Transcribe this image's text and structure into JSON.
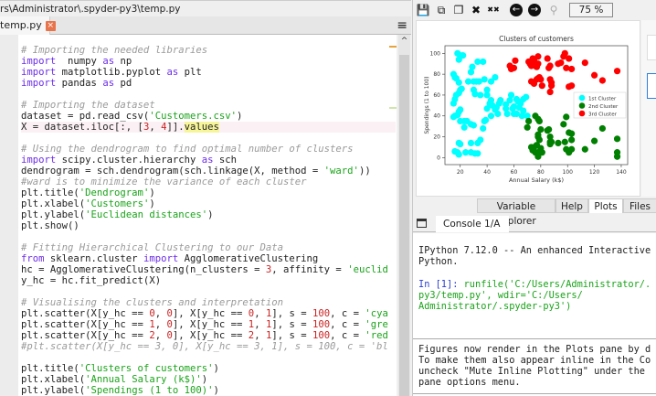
{
  "editor": {
    "path": "rs\\Administrator\\.spyder-py3\\temp.py",
    "tab_label": "temp.py",
    "close_glyph": "×",
    "menu_glyph": "≡",
    "scroll_up_glyph": "^",
    "lines": [
      [
        [
          "cm",
          "# Importing the needed libraries"
        ]
      ],
      [
        [
          "kw",
          "import"
        ],
        [
          "",
          "  numpy "
        ],
        [
          "kw",
          "as"
        ],
        [
          "",
          " np"
        ]
      ],
      [
        [
          "kw",
          "import"
        ],
        [
          "",
          " matplotlib.pyplot "
        ],
        [
          "kw",
          "as"
        ],
        [
          "",
          " plt"
        ]
      ],
      [
        [
          "kw",
          "import"
        ],
        [
          "",
          " pandas "
        ],
        [
          "kw",
          "as"
        ],
        [
          "",
          " pd"
        ]
      ],
      [],
      [
        [
          "cm",
          "# Importing the dataset"
        ]
      ],
      [
        [
          "",
          "dataset = pd.read_csv("
        ],
        [
          "st",
          "'Customers.csv'"
        ],
        [
          "",
          ")"
        ]
      ],
      [
        [
          "",
          "X = dataset.iloc[:, ["
        ],
        [
          "nu",
          "3"
        ],
        [
          "",
          ", "
        ],
        [
          "nu",
          "4"
        ],
        [
          "",
          "]]."
        ],
        [
          "hl",
          "values"
        ]
      ],
      [],
      [
        [
          "cm",
          "# Using the dendrogram to find optimal number of clusters"
        ]
      ],
      [
        [
          "kw",
          "import"
        ],
        [
          "",
          " scipy.cluster.hierarchy "
        ],
        [
          "kw",
          "as"
        ],
        [
          "",
          " sch"
        ]
      ],
      [
        [
          "",
          "dendrogram = sch.dendrogram(sch.linkage(X, method = "
        ],
        [
          "st",
          "'ward'"
        ],
        [
          "",
          "))"
        ]
      ],
      [
        [
          "cm",
          "#ward is to minimize the variance of each cluster"
        ]
      ],
      [
        [
          "",
          "plt.title("
        ],
        [
          "st",
          "'Dendrogram'"
        ],
        [
          "",
          ")"
        ]
      ],
      [
        [
          "",
          "plt.xlabel("
        ],
        [
          "st",
          "'Customers'"
        ],
        [
          "",
          ")"
        ]
      ],
      [
        [
          "",
          "plt.ylabel("
        ],
        [
          "st",
          "'Euclidean distances'"
        ],
        [
          "",
          ")"
        ]
      ],
      [
        [
          "",
          "plt.show()"
        ]
      ],
      [],
      [
        [
          "cm",
          "# Fitting Hierarchical Clustering to our Data"
        ]
      ],
      [
        [
          "kw",
          "from"
        ],
        [
          "",
          " sklearn.cluster "
        ],
        [
          "kw",
          "import"
        ],
        [
          "",
          " AgglomerativeClustering"
        ]
      ],
      [
        [
          "",
          "hc = AgglomerativeClustering(n_clusters = "
        ],
        [
          "nu",
          "3"
        ],
        [
          "",
          ", affinity = "
        ],
        [
          "st",
          "'euclid"
        ]
      ],
      [
        [
          "",
          "y_hc = hc.fit_predict(X)"
        ]
      ],
      [],
      [
        [
          "cm",
          "# Visualising the clusters and interpretation"
        ]
      ],
      [
        [
          "",
          "plt.scatter(X[y_hc == "
        ],
        [
          "nu",
          "0"
        ],
        [
          "",
          ", "
        ],
        [
          "nu",
          "0"
        ],
        [
          "",
          "], X[y_hc == "
        ],
        [
          "nu",
          "0"
        ],
        [
          "",
          ", "
        ],
        [
          "nu",
          "1"
        ],
        [
          "",
          "], s = "
        ],
        [
          "nu",
          "100"
        ],
        [
          "",
          ", c = "
        ],
        [
          "st",
          "'cya"
        ]
      ],
      [
        [
          "",
          "plt.scatter(X[y_hc == "
        ],
        [
          "nu",
          "1"
        ],
        [
          "",
          ", "
        ],
        [
          "nu",
          "0"
        ],
        [
          "",
          "], X[y_hc == "
        ],
        [
          "nu",
          "1"
        ],
        [
          "",
          ", "
        ],
        [
          "nu",
          "1"
        ],
        [
          "",
          "], s = "
        ],
        [
          "nu",
          "100"
        ],
        [
          "",
          ", c = "
        ],
        [
          "st",
          "'gre"
        ]
      ],
      [
        [
          "",
          "plt.scatter(X[y_hc == "
        ],
        [
          "nu",
          "2"
        ],
        [
          "",
          ", "
        ],
        [
          "nu",
          "0"
        ],
        [
          "",
          "], X[y_hc == "
        ],
        [
          "nu",
          "2"
        ],
        [
          "",
          ", "
        ],
        [
          "nu",
          "1"
        ],
        [
          "",
          "], s = "
        ],
        [
          "nu",
          "100"
        ],
        [
          "",
          ", c = "
        ],
        [
          "st",
          "'red"
        ]
      ],
      [
        [
          "cm",
          "#plt.scatter(X[y_hc == 3, 0], X[y_hc == 3, 1], s = 100, c = 'bl"
        ]
      ],
      [],
      [
        [
          "",
          "plt.title("
        ],
        [
          "st",
          "'Clusters of customers'"
        ],
        [
          "",
          ")"
        ]
      ],
      [
        [
          "",
          "plt.xlabel("
        ],
        [
          "st",
          "'Annual Salary (k$)'"
        ],
        [
          "",
          ")"
        ]
      ],
      [
        [
          "",
          "plt.ylabel("
        ],
        [
          "st",
          "'Spendings (1 to 100)'"
        ],
        [
          "",
          ")"
        ]
      ]
    ]
  },
  "plots_toolbar": {
    "zoom_level": "75 %",
    "icons": [
      "save-icon",
      "save-all-icon",
      "copy-icon",
      "close-icon",
      "close-all-icon",
      "previous-icon",
      "next-icon",
      "zoom-out-icon",
      "zoom-in-icon"
    ]
  },
  "pane_tabs": [
    "Variable explorer",
    "Help",
    "Plots",
    "Files"
  ],
  "active_pane_tab": "Plots",
  "console": {
    "tab_label": "Console 1/A",
    "close_glyph": "×",
    "banner": [
      "IPython 7.12.0 -- An enhanced Interactive",
      "Python."
    ],
    "prompt": "In [1]: ",
    "input_lines": [
      "runfile('C:/Users/Administrator/.",
      "py3/temp.py', wdir='C:/Users/",
      "Administrator/.spyder-py3')"
    ],
    "notice": [
      "Figures now render in the Plots pane by d",
      "To make them also appear inline in the Co",
      "uncheck \"Mute Inline Plotting\" under the",
      "pane options menu."
    ]
  },
  "colors": {
    "cluster1": "#00ffff",
    "cluster2": "#008000",
    "cluster3": "#ff0000",
    "keyword": "#6d2ee8",
    "string": "#1aa31a",
    "number": "#cc2222"
  },
  "chart_data": {
    "type": "scatter",
    "title": "Clusters of customers",
    "xlabel": "Annual Salary (k$)",
    "ylabel": "Spendings (1 to 100)",
    "xlim": [
      8.6,
      144.8
    ],
    "ylim": [
      -6.7,
      107.3
    ],
    "xticks": [
      20,
      40,
      60,
      80,
      100,
      120,
      140
    ],
    "yticks": [
      0,
      20,
      40,
      60,
      80,
      100
    ],
    "legend_position": "center-right",
    "series": [
      {
        "name": "1st Cluster",
        "color": "#00ffff",
        "points": [
          [
            15,
            80
          ],
          [
            16,
            77
          ],
          [
            17,
            76
          ],
          [
            19,
            72
          ],
          [
            18,
            100
          ],
          [
            20,
            98
          ],
          [
            22,
            98
          ],
          [
            19,
            94
          ],
          [
            15,
            52
          ],
          [
            16,
            56
          ],
          [
            17,
            60
          ],
          [
            19,
            62
          ],
          [
            20,
            65
          ],
          [
            21,
            66
          ],
          [
            15,
            39
          ],
          [
            16,
            40
          ],
          [
            18,
            41
          ],
          [
            19,
            44
          ],
          [
            20,
            46
          ],
          [
            20,
            35
          ],
          [
            23,
            35
          ],
          [
            25,
            35
          ],
          [
            23,
            29
          ],
          [
            28,
            32
          ],
          [
            30,
            31
          ],
          [
            19,
            14
          ],
          [
            20,
            13
          ],
          [
            16,
            6
          ],
          [
            18,
            5
          ],
          [
            19,
            3
          ],
          [
            24,
            5
          ],
          [
            28,
            5
          ],
          [
            31,
            4
          ],
          [
            33,
            4
          ],
          [
            33,
            14
          ],
          [
            35,
            17
          ],
          [
            28,
            14
          ],
          [
            26,
            73
          ],
          [
            28,
            82
          ],
          [
            29,
            87
          ],
          [
            30,
            73
          ],
          [
            32,
            73
          ],
          [
            33,
            92
          ],
          [
            37,
            92
          ],
          [
            34,
            73
          ],
          [
            38,
            75
          ],
          [
            40,
            65
          ],
          [
            40,
            60
          ],
          [
            43,
            73
          ],
          [
            46,
            77
          ],
          [
            37,
            28
          ],
          [
            38,
            35
          ],
          [
            39,
            36
          ],
          [
            40,
            47
          ],
          [
            42,
            52
          ],
          [
            43,
            55
          ],
          [
            44,
            50
          ],
          [
            46,
            46
          ],
          [
            48,
            42
          ],
          [
            49,
            52
          ],
          [
            50,
            55
          ],
          [
            54,
            47
          ],
          [
            54,
            51
          ],
          [
            57,
            55
          ],
          [
            58,
            60
          ],
          [
            59,
            47
          ],
          [
            60,
            42
          ],
          [
            60,
            49
          ],
          [
            62,
            56
          ],
          [
            63,
            54
          ],
          [
            64,
            48
          ],
          [
            65,
            52
          ],
          [
            67,
            56
          ],
          [
            67,
            45
          ],
          [
            69,
            58
          ],
          [
            70,
            40
          ],
          [
            30,
            65
          ],
          [
            31,
            61
          ],
          [
            35,
            60
          ],
          [
            43,
            40
          ],
          [
            47,
            48
          ],
          [
            55,
            42
          ],
          [
            62,
            42
          ],
          [
            66,
            40
          ]
        ]
      },
      {
        "name": "2nd Cluster",
        "color": "#008000",
        "points": [
          [
            70,
            29
          ],
          [
            71,
            35
          ],
          [
            73,
            10
          ],
          [
            74,
            7
          ],
          [
            75,
            10
          ],
          [
            76,
            5
          ],
          [
            77,
            12
          ],
          [
            78,
            5
          ],
          [
            78,
            20
          ],
          [
            78,
            22
          ],
          [
            78,
            37
          ],
          [
            79,
            35
          ],
          [
            79,
            17
          ],
          [
            80,
            9
          ],
          [
            81,
            5
          ],
          [
            85,
            26
          ],
          [
            86,
            27
          ],
          [
            87,
            13
          ],
          [
            87,
            15
          ],
          [
            87,
            20
          ],
          [
            88,
            15
          ],
          [
            93,
            14
          ],
          [
            97,
            32
          ],
          [
            98,
            15
          ],
          [
            99,
            39
          ],
          [
            101,
            24
          ],
          [
            103,
            23
          ],
          [
            103,
            17
          ],
          [
            103,
            8
          ],
          [
            99,
            8
          ],
          [
            101,
            5
          ],
          [
            113,
            8
          ],
          [
            120,
            16
          ],
          [
            126,
            28
          ],
          [
            137,
            18
          ],
          [
            137,
            1
          ],
          [
            137,
            5
          ],
          [
            78,
            1
          ],
          [
            80,
            27
          ],
          [
            76,
            40
          ]
        ]
      },
      {
        "name": "3rd Cluster",
        "color": "#ff0000",
        "points": [
          [
            57,
            88
          ],
          [
            58,
            85
          ],
          [
            60,
            86
          ],
          [
            61,
            93
          ],
          [
            71,
            92
          ],
          [
            72,
            90
          ],
          [
            73,
            88
          ],
          [
            74,
            95
          ],
          [
            75,
            93
          ],
          [
            76,
            88
          ],
          [
            77,
            87
          ],
          [
            78,
            97
          ],
          [
            78,
            90
          ],
          [
            78,
            76
          ],
          [
            73,
            73
          ],
          [
            75,
            71
          ],
          [
            77,
            75
          ],
          [
            79,
            77
          ],
          [
            80,
            75
          ],
          [
            81,
            69
          ],
          [
            85,
            95
          ],
          [
            86,
            86
          ],
          [
            87,
            88
          ],
          [
            87,
            75
          ],
          [
            88,
            69
          ],
          [
            87,
            63
          ],
          [
            88,
            72
          ],
          [
            93,
            90
          ],
          [
            95,
            91
          ],
          [
            97,
            97
          ],
          [
            98,
            100
          ],
          [
            99,
            86
          ],
          [
            101,
            95
          ],
          [
            103,
            85
          ],
          [
            101,
            68
          ],
          [
            103,
            69
          ],
          [
            113,
            91
          ],
          [
            120,
            79
          ],
          [
            126,
            74
          ],
          [
            137,
            83
          ]
        ]
      }
    ]
  }
}
